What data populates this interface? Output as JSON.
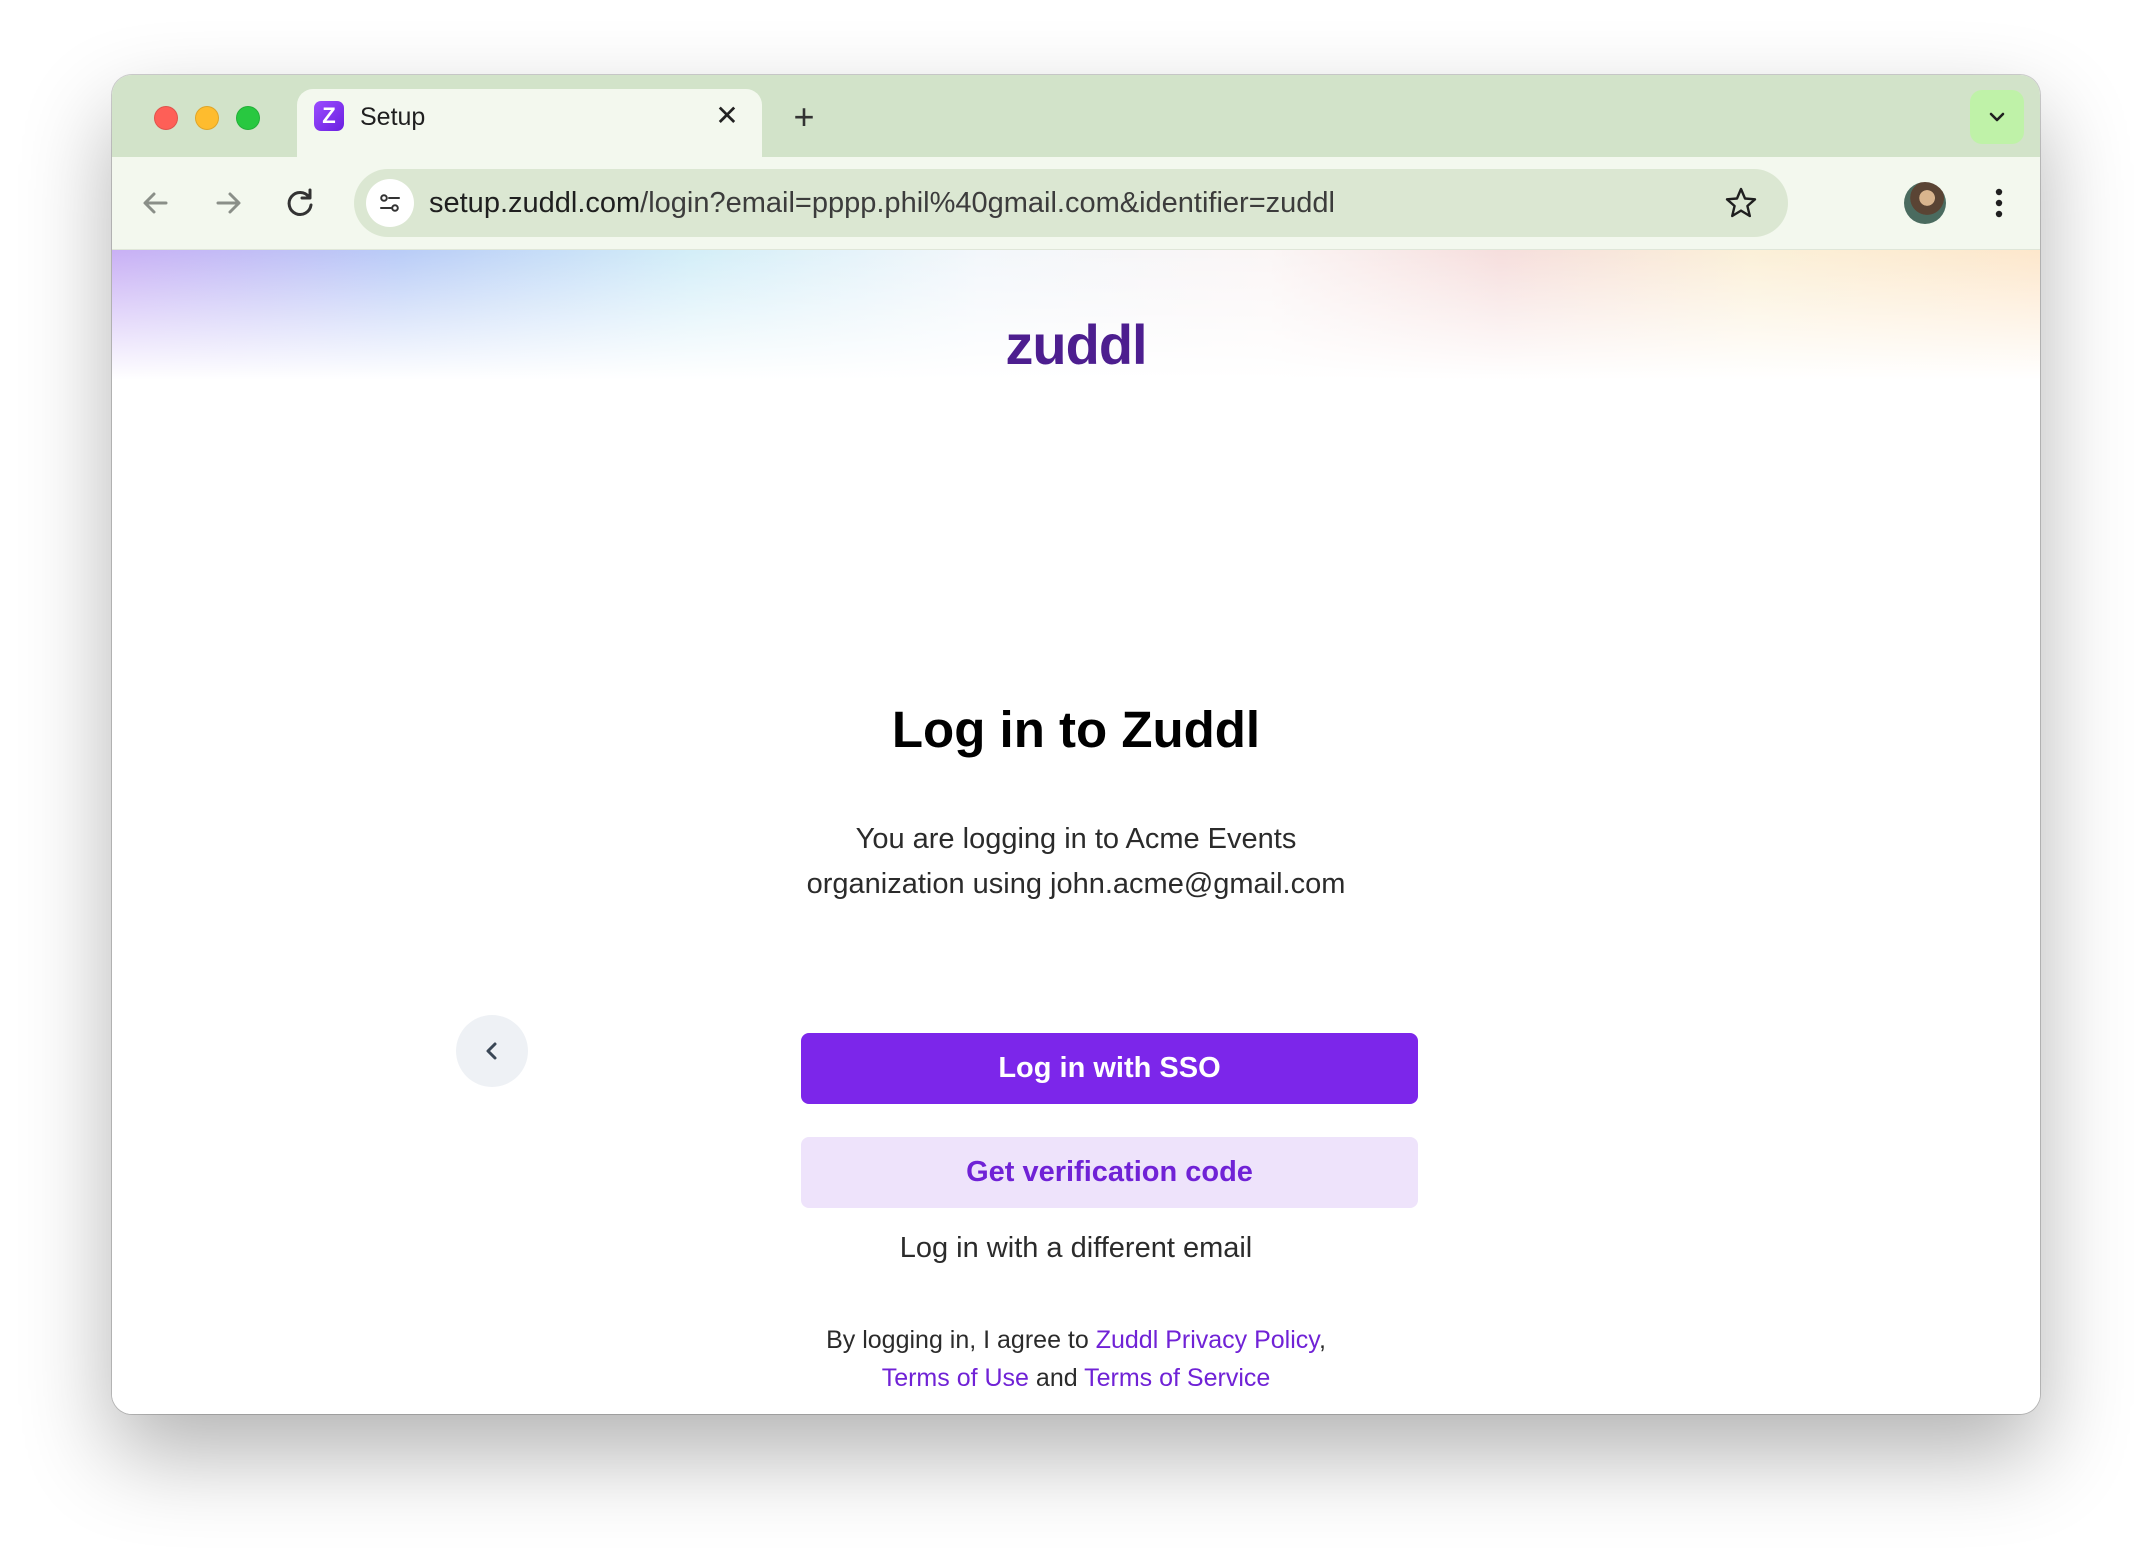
{
  "browser": {
    "tab": {
      "title": "Setup",
      "favicon_letter": "Z",
      "close_glyph": "✕"
    },
    "new_tab_glyph": "+",
    "url": {
      "host": "setup.zuddl.com",
      "path": "/login?email=pppp.phil%40gmail.com&identifier=zuddl"
    }
  },
  "page": {
    "logo": "zuddl",
    "heading": "Log in to Zuddl",
    "subtitle_line1": "You are logging in to Acme Events",
    "subtitle_line2": "organization using john.acme@gmail.com",
    "sso_button": "Log in with SSO",
    "code_button": "Get verification code",
    "different_email": "Log in with a different email",
    "legal": {
      "prefix": "By logging in, I agree to ",
      "privacy": "Zuddl Privacy Policy",
      "comma": ",",
      "terms_use": "Terms of Use",
      "and": " and ",
      "terms_service": "Terms of Service"
    }
  },
  "colors": {
    "brand_purple": "#7c26ea",
    "brand_light": "#eee3fb",
    "logo": "#4d1e8f",
    "tabstrip": "#d2e3c9"
  },
  "icons": {
    "back": "arrow-left-icon",
    "forward": "arrow-right-icon",
    "reload": "reload-icon",
    "site_info": "tune-icon",
    "bookmark": "star-icon",
    "menu": "kebab-icon",
    "tab_menu": "chevron-down-icon",
    "page_back": "chevron-left-icon"
  }
}
